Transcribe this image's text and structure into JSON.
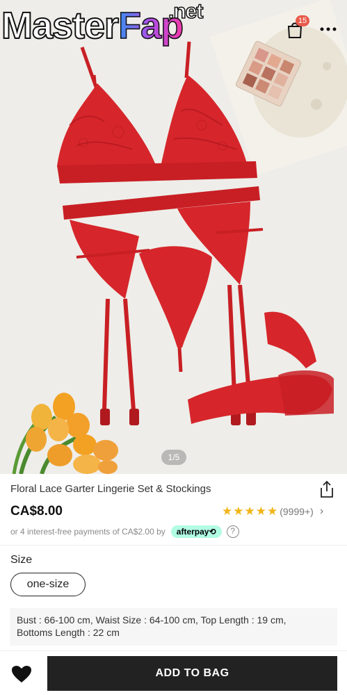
{
  "watermark": {
    "part1": "Master",
    "part2": "Fap",
    "part3": ".net"
  },
  "header": {
    "cart_count": "15"
  },
  "gallery": {
    "indicator": "1/5"
  },
  "product": {
    "title": "Floral Lace Garter Lingerie Set & Stockings",
    "price": "CA$8.00",
    "stars": "★★★★★",
    "rating_count": "(9999+)",
    "rating_chevron": "›",
    "installments_text": "or 4 interest-free payments of CA$2.00 by",
    "afterpay_label": "afterpay⟲",
    "help_label": "?"
  },
  "size": {
    "label": "Size",
    "selected": "one-size"
  },
  "measurements": {
    "line1": "Bust : 66-100 cm,  Waist Size : 64-100 cm,  Top Length : 19 cm,",
    "line2": "Bottoms Length : 22 cm"
  },
  "actions": {
    "add_to_bag": "ADD TO BAG"
  },
  "colors": {
    "accent": "#222222",
    "lace": "#d6262b",
    "afterpay": "#b2fce4",
    "star": "#f2b518",
    "badge": "#e85a4a"
  }
}
